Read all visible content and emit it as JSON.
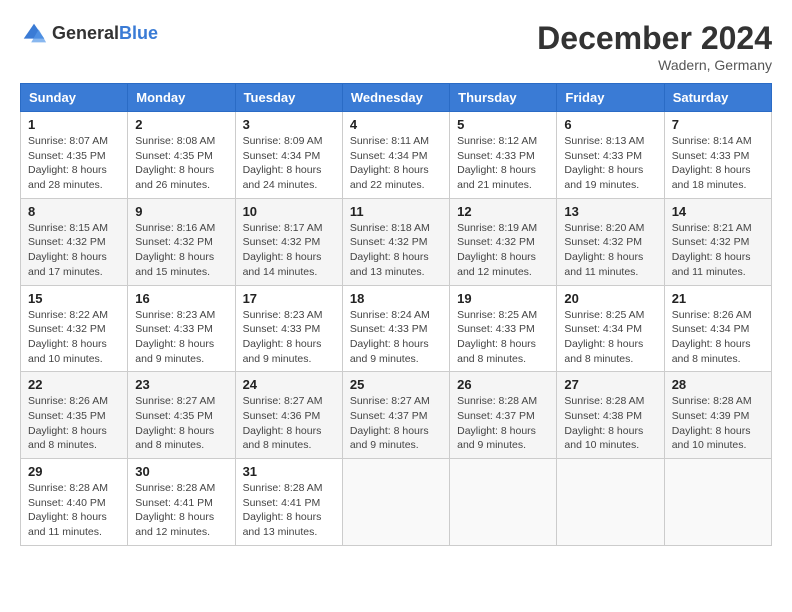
{
  "logo": {
    "general": "General",
    "blue": "Blue"
  },
  "title": "December 2024",
  "location": "Wadern, Germany",
  "days_of_week": [
    "Sunday",
    "Monday",
    "Tuesday",
    "Wednesday",
    "Thursday",
    "Friday",
    "Saturday"
  ],
  "weeks": [
    [
      {
        "day": "1",
        "sunrise": "8:07 AM",
        "sunset": "4:35 PM",
        "daylight": "8 hours and 28 minutes."
      },
      {
        "day": "2",
        "sunrise": "8:08 AM",
        "sunset": "4:35 PM",
        "daylight": "8 hours and 26 minutes."
      },
      {
        "day": "3",
        "sunrise": "8:09 AM",
        "sunset": "4:34 PM",
        "daylight": "8 hours and 24 minutes."
      },
      {
        "day": "4",
        "sunrise": "8:11 AM",
        "sunset": "4:34 PM",
        "daylight": "8 hours and 22 minutes."
      },
      {
        "day": "5",
        "sunrise": "8:12 AM",
        "sunset": "4:33 PM",
        "daylight": "8 hours and 21 minutes."
      },
      {
        "day": "6",
        "sunrise": "8:13 AM",
        "sunset": "4:33 PM",
        "daylight": "8 hours and 19 minutes."
      },
      {
        "day": "7",
        "sunrise": "8:14 AM",
        "sunset": "4:33 PM",
        "daylight": "8 hours and 18 minutes."
      }
    ],
    [
      {
        "day": "8",
        "sunrise": "8:15 AM",
        "sunset": "4:32 PM",
        "daylight": "8 hours and 17 minutes."
      },
      {
        "day": "9",
        "sunrise": "8:16 AM",
        "sunset": "4:32 PM",
        "daylight": "8 hours and 15 minutes."
      },
      {
        "day": "10",
        "sunrise": "8:17 AM",
        "sunset": "4:32 PM",
        "daylight": "8 hours and 14 minutes."
      },
      {
        "day": "11",
        "sunrise": "8:18 AM",
        "sunset": "4:32 PM",
        "daylight": "8 hours and 13 minutes."
      },
      {
        "day": "12",
        "sunrise": "8:19 AM",
        "sunset": "4:32 PM",
        "daylight": "8 hours and 12 minutes."
      },
      {
        "day": "13",
        "sunrise": "8:20 AM",
        "sunset": "4:32 PM",
        "daylight": "8 hours and 11 minutes."
      },
      {
        "day": "14",
        "sunrise": "8:21 AM",
        "sunset": "4:32 PM",
        "daylight": "8 hours and 11 minutes."
      }
    ],
    [
      {
        "day": "15",
        "sunrise": "8:22 AM",
        "sunset": "4:32 PM",
        "daylight": "8 hours and 10 minutes."
      },
      {
        "day": "16",
        "sunrise": "8:23 AM",
        "sunset": "4:33 PM",
        "daylight": "8 hours and 9 minutes."
      },
      {
        "day": "17",
        "sunrise": "8:23 AM",
        "sunset": "4:33 PM",
        "daylight": "8 hours and 9 minutes."
      },
      {
        "day": "18",
        "sunrise": "8:24 AM",
        "sunset": "4:33 PM",
        "daylight": "8 hours and 9 minutes."
      },
      {
        "day": "19",
        "sunrise": "8:25 AM",
        "sunset": "4:33 PM",
        "daylight": "8 hours and 8 minutes."
      },
      {
        "day": "20",
        "sunrise": "8:25 AM",
        "sunset": "4:34 PM",
        "daylight": "8 hours and 8 minutes."
      },
      {
        "day": "21",
        "sunrise": "8:26 AM",
        "sunset": "4:34 PM",
        "daylight": "8 hours and 8 minutes."
      }
    ],
    [
      {
        "day": "22",
        "sunrise": "8:26 AM",
        "sunset": "4:35 PM",
        "daylight": "8 hours and 8 minutes."
      },
      {
        "day": "23",
        "sunrise": "8:27 AM",
        "sunset": "4:35 PM",
        "daylight": "8 hours and 8 minutes."
      },
      {
        "day": "24",
        "sunrise": "8:27 AM",
        "sunset": "4:36 PM",
        "daylight": "8 hours and 8 minutes."
      },
      {
        "day": "25",
        "sunrise": "8:27 AM",
        "sunset": "4:37 PM",
        "daylight": "8 hours and 9 minutes."
      },
      {
        "day": "26",
        "sunrise": "8:28 AM",
        "sunset": "4:37 PM",
        "daylight": "8 hours and 9 minutes."
      },
      {
        "day": "27",
        "sunrise": "8:28 AM",
        "sunset": "4:38 PM",
        "daylight": "8 hours and 10 minutes."
      },
      {
        "day": "28",
        "sunrise": "8:28 AM",
        "sunset": "4:39 PM",
        "daylight": "8 hours and 10 minutes."
      }
    ],
    [
      {
        "day": "29",
        "sunrise": "8:28 AM",
        "sunset": "4:40 PM",
        "daylight": "8 hours and 11 minutes."
      },
      {
        "day": "30",
        "sunrise": "8:28 AM",
        "sunset": "4:41 PM",
        "daylight": "8 hours and 12 minutes."
      },
      {
        "day": "31",
        "sunrise": "8:28 AM",
        "sunset": "4:41 PM",
        "daylight": "8 hours and 13 minutes."
      },
      null,
      null,
      null,
      null
    ]
  ],
  "labels": {
    "sunrise": "Sunrise:",
    "sunset": "Sunset:",
    "daylight": "Daylight:"
  }
}
